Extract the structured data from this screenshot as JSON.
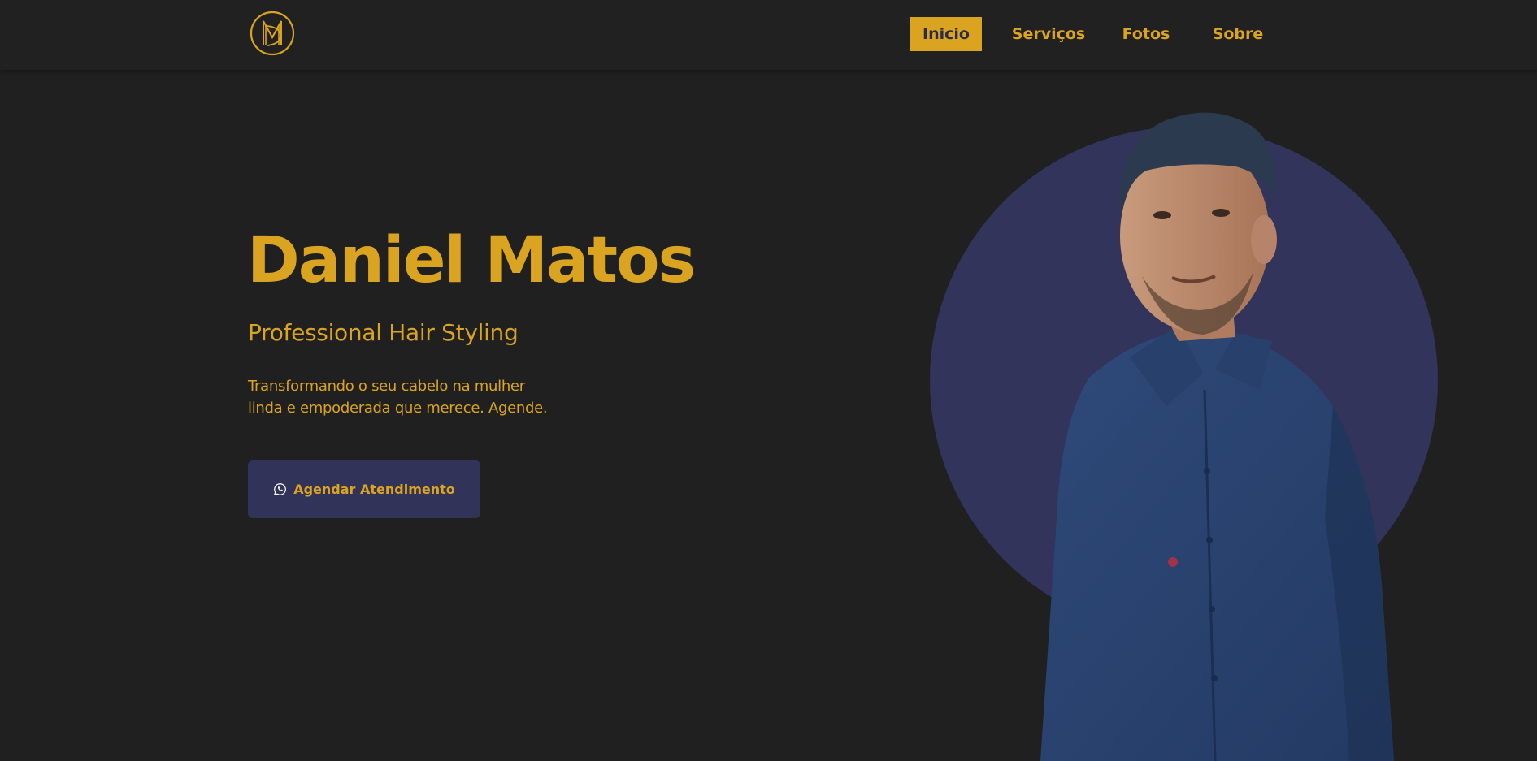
{
  "header": {
    "logo_icon": "md-monogram-logo-icon",
    "nav": [
      {
        "label": "Inicio",
        "active": true
      },
      {
        "label": "Serviços",
        "active": false
      },
      {
        "label": "Fotos",
        "active": false
      },
      {
        "label": "Sobre",
        "active": false
      }
    ]
  },
  "hero": {
    "title": "Daniel Matos",
    "subtitle": "Professional Hair Styling",
    "description": "Transformando o seu cabelo na mulher linda e empoderada que merece. Agende.",
    "cta_label": "Agendar Atendimento",
    "cta_icon": "whatsapp-icon"
  },
  "colors": {
    "background": "#202020",
    "accent": "#dba420",
    "navy": "#323358"
  }
}
